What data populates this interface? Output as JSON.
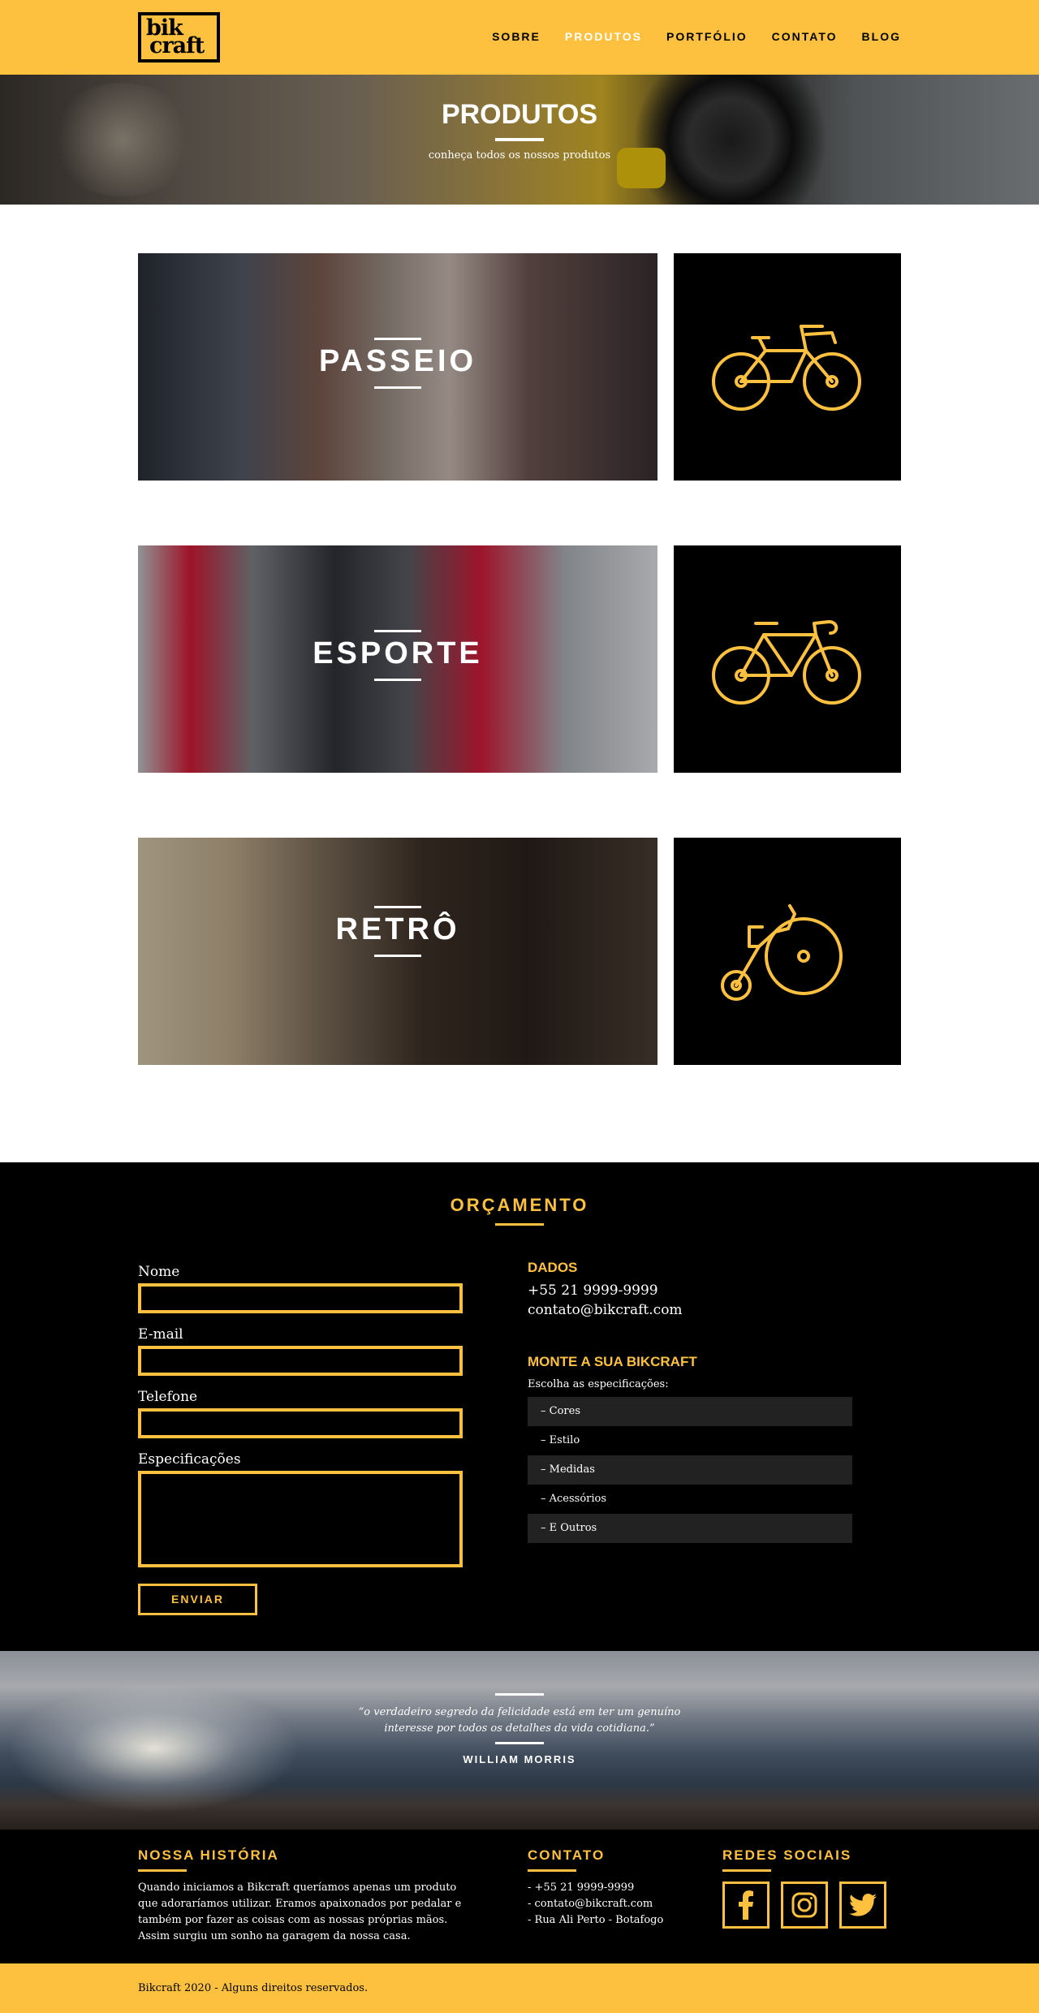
{
  "header": {
    "logo_line1": "bik",
    "logo_line2": "craft",
    "nav": [
      "SOBRE",
      "PRODUTOS",
      "PORTFÓLIO",
      "CONTATO",
      "BLOG"
    ]
  },
  "hero": {
    "title": "PRODUTOS",
    "subtitle": "conheça todos os nossos produtos"
  },
  "products": [
    {
      "title": "PASSEIO",
      "icon": "city-bike-icon"
    },
    {
      "title": "ESPORTE",
      "icon": "sport-bike-icon"
    },
    {
      "title": "RETRÔ",
      "icon": "penny-farthing-icon"
    }
  ],
  "orcamento": {
    "title": "ORÇAMENTO",
    "fields": {
      "nome": "Nome",
      "email": "E-mail",
      "telefone": "Telefone",
      "especificacoes": "Especificações"
    },
    "submit": "ENVIAR",
    "dados_title": "DADOS",
    "phone": "+55 21 9999-9999",
    "email": "contato@bikcraft.com",
    "monte_title": "MONTE A SUA BIKCRAFT",
    "escolha": "Escolha as especificações:",
    "specs": [
      "– Cores",
      "– Estilo",
      "– Medidas",
      "– Acessórios",
      "– E Outros"
    ]
  },
  "quote": {
    "text": "“o verdadeiro segredo da felicidade está em ter um genuíno interesse por todos os detalhes da vida cotidiana.”",
    "author": "WILLIAM MORRIS"
  },
  "footer": {
    "historia_title": "NOSSA HISTÓRIA",
    "historia_text": "Quando iniciamos a Bikcraft queríamos apenas um produto que adoraríamos utilizar. Eramos apaixonados por pedalar e também por fazer as coisas com as nossas próprias mãos. Assim surgiu um sonho na garagem da nossa casa.",
    "contato_title": "CONTATO",
    "contato": [
      "- +55 21 9999-9999",
      "- contato@bikcraft.com",
      "- Rua Ali Perto - Botafogo"
    ],
    "redes_title": "REDES SOCIAIS",
    "redes": [
      "facebook-icon",
      "instagram-icon",
      "twitter-icon"
    ]
  },
  "copyright": "Bikcraft 2020 - Alguns direitos reservados.",
  "colors": {
    "accent": "#fdc13f",
    "dark": "#000000",
    "light": "#ffffff"
  }
}
